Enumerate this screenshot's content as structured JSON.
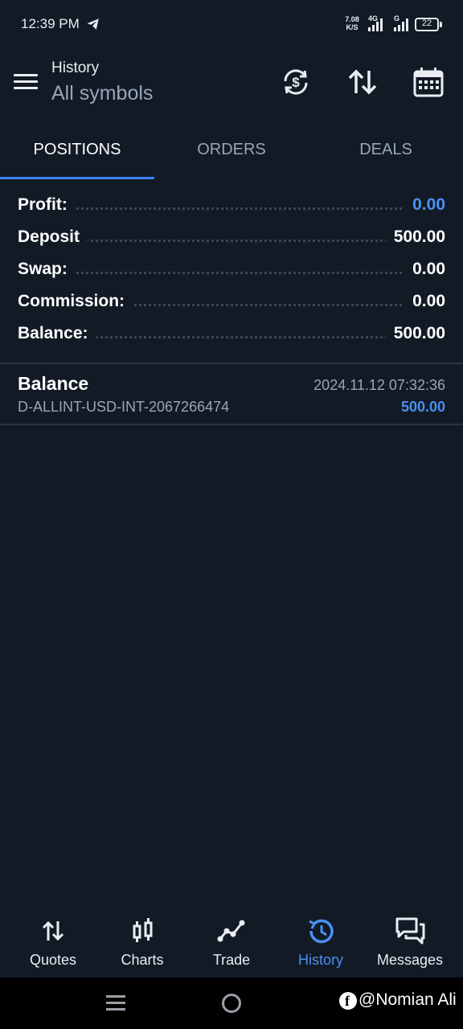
{
  "status_bar": {
    "time": "12:39 PM",
    "net_speed_value": "7.08",
    "net_speed_unit": "K/S",
    "sim1_label": "4G",
    "sim2_label": "G",
    "battery": "22"
  },
  "header": {
    "title": "History",
    "subtitle": "All symbols",
    "icons": [
      "currency-exchange-icon",
      "sort-icon",
      "calendar-icon"
    ]
  },
  "tabs": [
    {
      "label": "POSITIONS",
      "active": true
    },
    {
      "label": "ORDERS",
      "active": false
    },
    {
      "label": "DEALS",
      "active": false
    }
  ],
  "summary": [
    {
      "label": "Profit:",
      "value": "0.00",
      "highlight": true
    },
    {
      "label": "Deposit",
      "value": "500.00",
      "highlight": false
    },
    {
      "label": "Swap:",
      "value": "0.00",
      "highlight": false
    },
    {
      "label": "Commission:",
      "value": "0.00",
      "highlight": false
    },
    {
      "label": "Balance:",
      "value": "500.00",
      "highlight": false
    }
  ],
  "deals": [
    {
      "title": "Balance",
      "subtitle": "D-ALLINT-USD-INT-2067266474",
      "time": "2024.11.12 07:32:36",
      "amount": "500.00"
    }
  ],
  "bottom_nav": [
    {
      "label": "Quotes",
      "icon": "quotes-arrows-icon",
      "active": false
    },
    {
      "label": "Charts",
      "icon": "candlestick-icon",
      "active": false
    },
    {
      "label": "Trade",
      "icon": "trade-line-icon",
      "active": false
    },
    {
      "label": "History",
      "icon": "history-clock-icon",
      "active": true
    },
    {
      "label": "Messages",
      "icon": "chat-bubbles-icon",
      "active": false
    }
  ],
  "watermark": {
    "text": "@Nomian Ali",
    "logo_letter": "f"
  },
  "colors": {
    "background": "#121a25",
    "accent": "#4a90f0",
    "muted": "#98a6b9"
  }
}
